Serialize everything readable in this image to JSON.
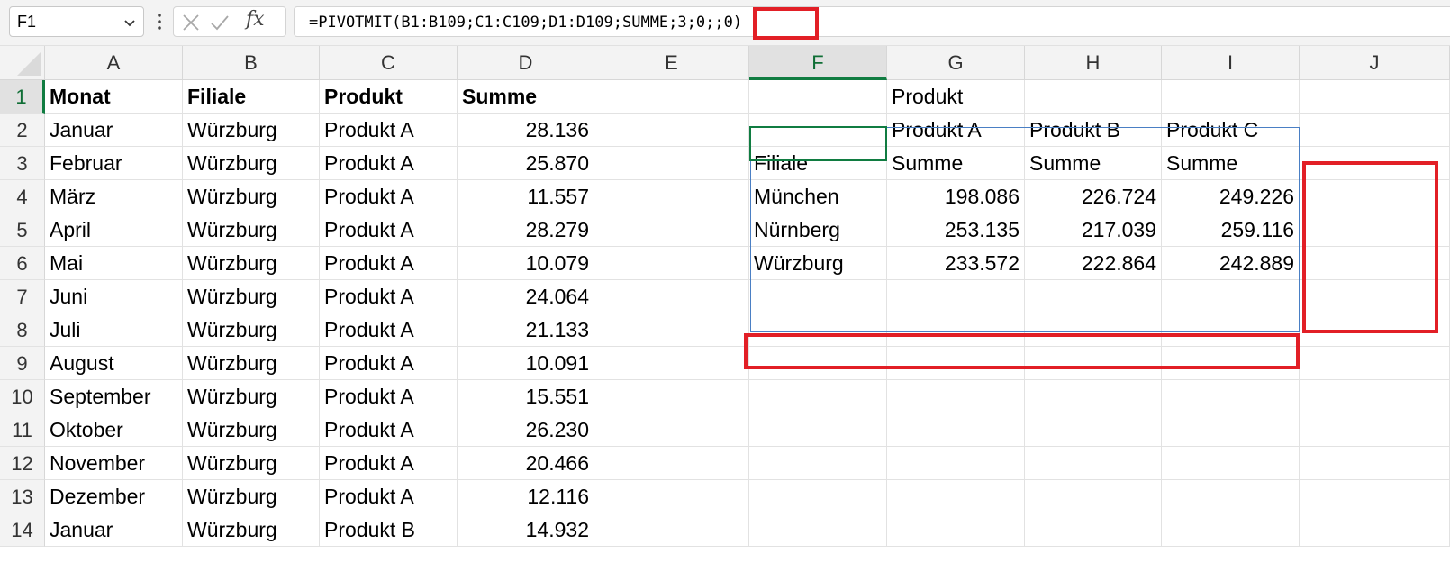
{
  "name_box": {
    "value": "F1"
  },
  "formula_bar": {
    "fx_label": "fx",
    "formula": "=PIVOTMIT(B1:B109;C1:C109;D1:D109;SUMME;3;0;;0)"
  },
  "columns": [
    "A",
    "B",
    "C",
    "D",
    "E",
    "F",
    "G",
    "H",
    "I",
    "J"
  ],
  "selected_column": "F",
  "rows": [
    "1",
    "2",
    "3",
    "4",
    "5",
    "6",
    "7",
    "8",
    "9",
    "10",
    "11",
    "12",
    "13",
    "14"
  ],
  "selected_row": "1",
  "source_table": {
    "headers": [
      "Monat",
      "Filiale",
      "Produkt",
      "Summe"
    ],
    "rows": [
      [
        "Januar",
        "Würzburg",
        "Produkt A",
        "28.136"
      ],
      [
        "Februar",
        "Würzburg",
        "Produkt A",
        "25.870"
      ],
      [
        "März",
        "Würzburg",
        "Produkt A",
        "11.557"
      ],
      [
        "April",
        "Würzburg",
        "Produkt A",
        "28.279"
      ],
      [
        "Mai",
        "Würzburg",
        "Produkt A",
        "10.079"
      ],
      [
        "Juni",
        "Würzburg",
        "Produkt A",
        "24.064"
      ],
      [
        "Juli",
        "Würzburg",
        "Produkt A",
        "21.133"
      ],
      [
        "August",
        "Würzburg",
        "Produkt A",
        "10.091"
      ],
      [
        "September",
        "Würzburg",
        "Produkt A",
        "15.551"
      ],
      [
        "Oktober",
        "Würzburg",
        "Produkt A",
        "26.230"
      ],
      [
        "November",
        "Würzburg",
        "Produkt A",
        "20.466"
      ],
      [
        "Dezember",
        "Würzburg",
        "Produkt A",
        "12.116"
      ],
      [
        "Januar",
        "Würzburg",
        "Produkt B",
        "14.932"
      ]
    ]
  },
  "pivot": {
    "row1": [
      "",
      "Produkt",
      "",
      ""
    ],
    "row2": [
      "",
      "Produkt A",
      "Produkt B",
      "Produkt C"
    ],
    "row3": [
      "Filiale",
      "Summe",
      "Summe",
      "Summe"
    ],
    "data": [
      [
        "München",
        "198.086",
        "226.724",
        "249.226"
      ],
      [
        "Nürnberg",
        "253.135",
        "217.039",
        "259.116"
      ],
      [
        "Würzburg",
        "233.572",
        "222.864",
        "242.889"
      ]
    ]
  },
  "colors": {
    "highlight": "#e21f26",
    "selection": "#107c41",
    "spill_border": "#4a7fc4"
  }
}
